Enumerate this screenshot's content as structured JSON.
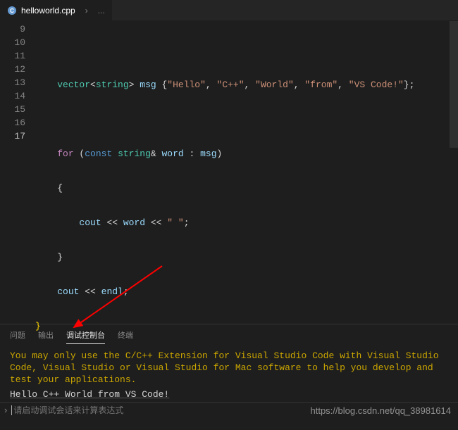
{
  "tab": {
    "title": "helloworld.cpp",
    "breadcrumb": "..."
  },
  "gutter": {
    "start": 9,
    "end": 17,
    "active": 17
  },
  "code": {
    "l9": "",
    "l10": {
      "indent": "    ",
      "t1": "vector",
      "t2": "<",
      "t3": "string",
      "t4": ">",
      "t5": " msg ",
      "t6": "{",
      "s1": "\"Hello\"",
      "c": ", ",
      "s2": "\"C++\"",
      "s3": "\"World\"",
      "s4": "\"from\"",
      "s5": "\"VS Code!\"",
      "t7": "};"
    },
    "l11": "",
    "l12": {
      "indent": "    ",
      "kw": "for",
      "sp": " (",
      "cst": "const",
      "sp2": " ",
      "ty": "string",
      "amp": "&",
      "var": " word ",
      "col": ": ",
      "msg": "msg",
      "end": ")"
    },
    "l13": {
      "indent": "    ",
      "b": "{"
    },
    "l14": {
      "indent": "        ",
      "cout": "cout",
      "op": " << ",
      "word": "word",
      "op2": " << ",
      "str": "\" \"",
      "end": ";"
    },
    "l15": {
      "indent": "    ",
      "b": "}"
    },
    "l16": {
      "indent": "    ",
      "cout": "cout",
      "op": " << ",
      "endl": "endl",
      "end": ";"
    },
    "l17": {
      "b": "}"
    }
  },
  "panel": {
    "tabs": {
      "problems": "问题",
      "output": "输出",
      "debug": "调试控制台",
      "terminal": "终端"
    },
    "extMsg": "You may only use the C/C++ Extension for Visual Studio Code with Visual Studio Code, Visual Studio or Visual Studio for Mac software to help you develop and test your applications.",
    "output": "Hello C++ World from VS Code!",
    "inputPlaceholder": "请启动调试会话来计算表达式"
  },
  "watermark": "https://blog.csdn.net/qq_38981614"
}
